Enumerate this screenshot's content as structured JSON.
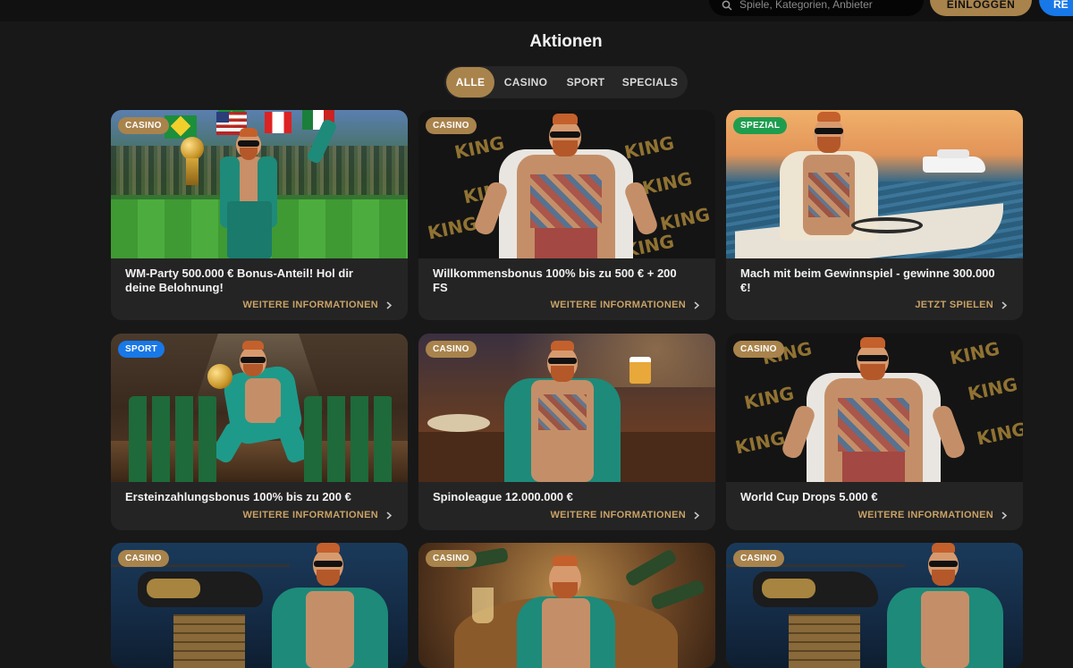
{
  "header": {
    "search_placeholder": "Spiele, Kategorien, Anbieter",
    "login_label": "EINLOGGEN",
    "register_label": "RE"
  },
  "page": {
    "title": "Aktionen"
  },
  "tabs": [
    {
      "label": "ALLE",
      "active": true
    },
    {
      "label": "CASINO",
      "active": false
    },
    {
      "label": "SPORT",
      "active": false
    },
    {
      "label": "SPECIALS",
      "active": false
    }
  ],
  "colors": {
    "accent": "#a9834c",
    "sport": "#1878e8",
    "spezial": "#1f9d4f",
    "cta": "#c9a266"
  },
  "promotions": [
    {
      "badge": "CASINO",
      "title": "WM-Party 500.000 € Bonus-Anteil! Hol dir deine Belohnung!",
      "cta": "WEITERE INFORMATIONEN"
    },
    {
      "badge": "CASINO",
      "title": "Willkommensbonus 100% bis zu 500 € + 200 FS",
      "cta": "WEITERE INFORMATIONEN"
    },
    {
      "badge": "SPEZIAL",
      "title": "Mach mit beim Gewinnspiel - gewinne 300.000 €!",
      "cta": "JETZT SPIELEN"
    },
    {
      "badge": "SPORT",
      "title": "Ersteinzahlungsbonus 100% bis zu 200 €",
      "cta": "WEITERE INFORMATIONEN"
    },
    {
      "badge": "CASINO",
      "title": "Spinoleague 12.000.000 €",
      "cta": "WEITERE INFORMATIONEN"
    },
    {
      "badge": "CASINO",
      "title": "World Cup Drops 5.000 €",
      "cta": "WEITERE INFORMATIONEN"
    },
    {
      "badge": "CASINO"
    },
    {
      "badge": "CASINO"
    },
    {
      "badge": "CASINO"
    }
  ],
  "banner_text": "KING"
}
